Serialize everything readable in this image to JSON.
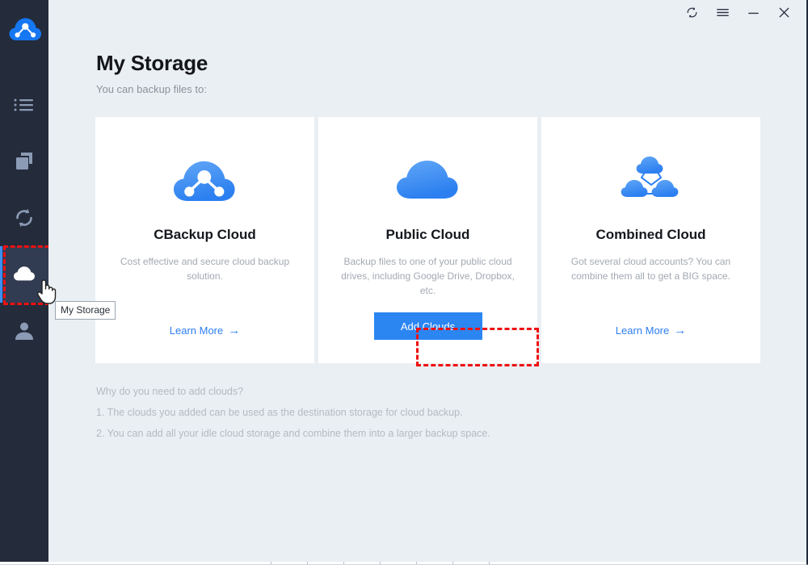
{
  "window": {
    "controls": [
      {
        "name": "refresh",
        "icon": "refresh-icon",
        "label": "Refresh"
      },
      {
        "name": "menu",
        "icon": "hamburger-menu-icon",
        "label": "Menu"
      },
      {
        "name": "minimize",
        "icon": "minimize-icon",
        "label": "Minimize"
      },
      {
        "name": "close",
        "icon": "close-icon",
        "label": "Close"
      }
    ]
  },
  "sidebar": {
    "logo_icon": "cbackup-logo-icon",
    "items": [
      {
        "id": "tasks",
        "icon": "list-icon",
        "label": "Tasks",
        "active": false
      },
      {
        "id": "backup",
        "icon": "copy-icon",
        "label": "Backup",
        "active": false
      },
      {
        "id": "sync",
        "icon": "sync-icon",
        "label": "Sync",
        "active": false
      },
      {
        "id": "my-storage",
        "icon": "cloud-icon",
        "label": "My Storage",
        "active": true
      },
      {
        "id": "account",
        "icon": "person-icon",
        "label": "Account",
        "active": false
      }
    ]
  },
  "tooltip": {
    "text": "My Storage"
  },
  "main": {
    "title": "My Storage",
    "subtitle": "You can backup files to:",
    "cards": [
      {
        "id": "cbackup-cloud",
        "icon": "network-cloud-icon",
        "title": "CBackup Cloud",
        "description": "Cost effective and secure cloud backup solution.",
        "action_type": "link",
        "action_label": "Learn More",
        "action_arrow": "→"
      },
      {
        "id": "public-cloud",
        "icon": "cloud-icon",
        "title": "Public Cloud",
        "description": "Backup files to one of your public cloud drives, including Google Drive, Dropbox, etc.",
        "action_type": "button",
        "action_label": "Add Clouds",
        "highlighted": true
      },
      {
        "id": "combined-cloud",
        "icon": "combined-cloud-icon",
        "title": "Combined Cloud",
        "description": "Got several cloud accounts? You can combine them all to get a BIG space.",
        "action_type": "link",
        "action_label": "Learn More",
        "action_arrow": "→"
      }
    ],
    "notes": [
      "Why do you need to add clouds?",
      "1. The clouds you added can be used as the destination storage for cloud backup.",
      "2. You can add all your idle cloud storage and combine them into a larger backup space."
    ]
  },
  "colors": {
    "sidebar_bg": "#242b3b",
    "sidebar_active_bg": "#313b51",
    "accent_blue": "#3c8ef0",
    "button_blue": "#2b86f2",
    "link_blue": "#2d7ef0",
    "content_bg": "#eaeff3",
    "card_bg": "#ffffff",
    "highlight_red": "#ee1111"
  }
}
